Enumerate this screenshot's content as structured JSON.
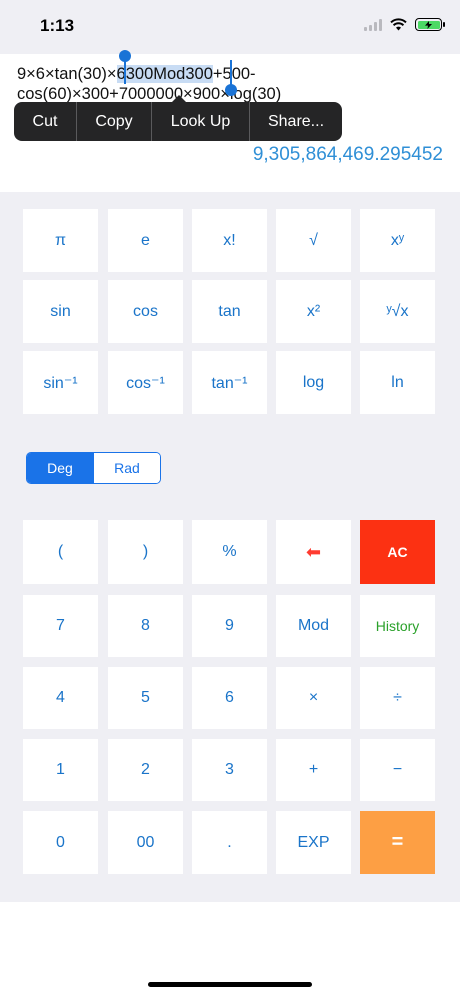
{
  "status": {
    "time": "1:13"
  },
  "display": {
    "expression_before": "9×6×tan(30)×",
    "expression_selected": "6300Mod300",
    "expression_after": "+500-cos(60)×300+7000000×900×log(30)",
    "result": "9,305,864,469.295452"
  },
  "context_menu": {
    "items": [
      "Cut",
      "Copy",
      "Look Up",
      "Share..."
    ]
  },
  "scientific_keys": {
    "row1": [
      "π",
      "e",
      "x!",
      "√",
      "xʸ"
    ],
    "row2": [
      "sin",
      "cos",
      "tan",
      "x²",
      "ʸ√x"
    ],
    "row3": [
      "sin⁻¹",
      "cos⁻¹",
      "tan⁻¹",
      "log",
      "ln"
    ]
  },
  "angle_mode": {
    "options": [
      "Deg",
      "Rad"
    ],
    "selected": "Deg"
  },
  "basic_keys": {
    "row1": [
      "(",
      ")",
      "%",
      "⬅",
      "AC"
    ],
    "row2": [
      "7",
      "8",
      "9",
      "Mod",
      "History"
    ],
    "row3": [
      "4",
      "5",
      "6",
      "×",
      "÷"
    ],
    "row4": [
      "1",
      "2",
      "3",
      "+",
      "−"
    ],
    "row5": [
      "0",
      "00",
      ".",
      "EXP",
      "="
    ]
  },
  "colors": {
    "accent": "#1a74c9",
    "clear": "#fc3112",
    "equals": "#fd9f44",
    "history": "#2aa12a",
    "result": "#2f8fd6"
  }
}
